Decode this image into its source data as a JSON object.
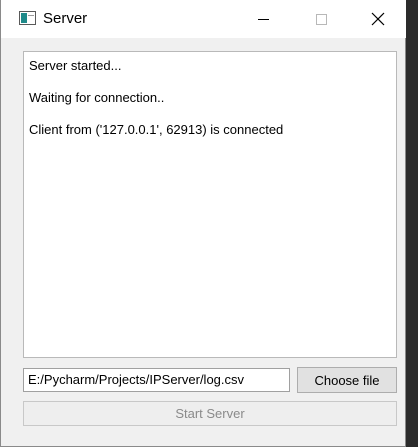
{
  "window": {
    "title": "Server"
  },
  "log": {
    "lines": [
      "Server started...",
      "Waiting for connection..",
      "Client from ('127.0.0.1', 62913) is connected"
    ]
  },
  "file": {
    "path_value": "E:/Pycharm/Projects/IPServer/log.csv",
    "choose_label": "Choose file"
  },
  "actions": {
    "start_label": "Start Server",
    "start_enabled": false
  },
  "colors": {
    "window_bg": "#f0f0f0",
    "titlebar_bg": "#ffffff",
    "disabled_text": "#8a8a8a"
  }
}
